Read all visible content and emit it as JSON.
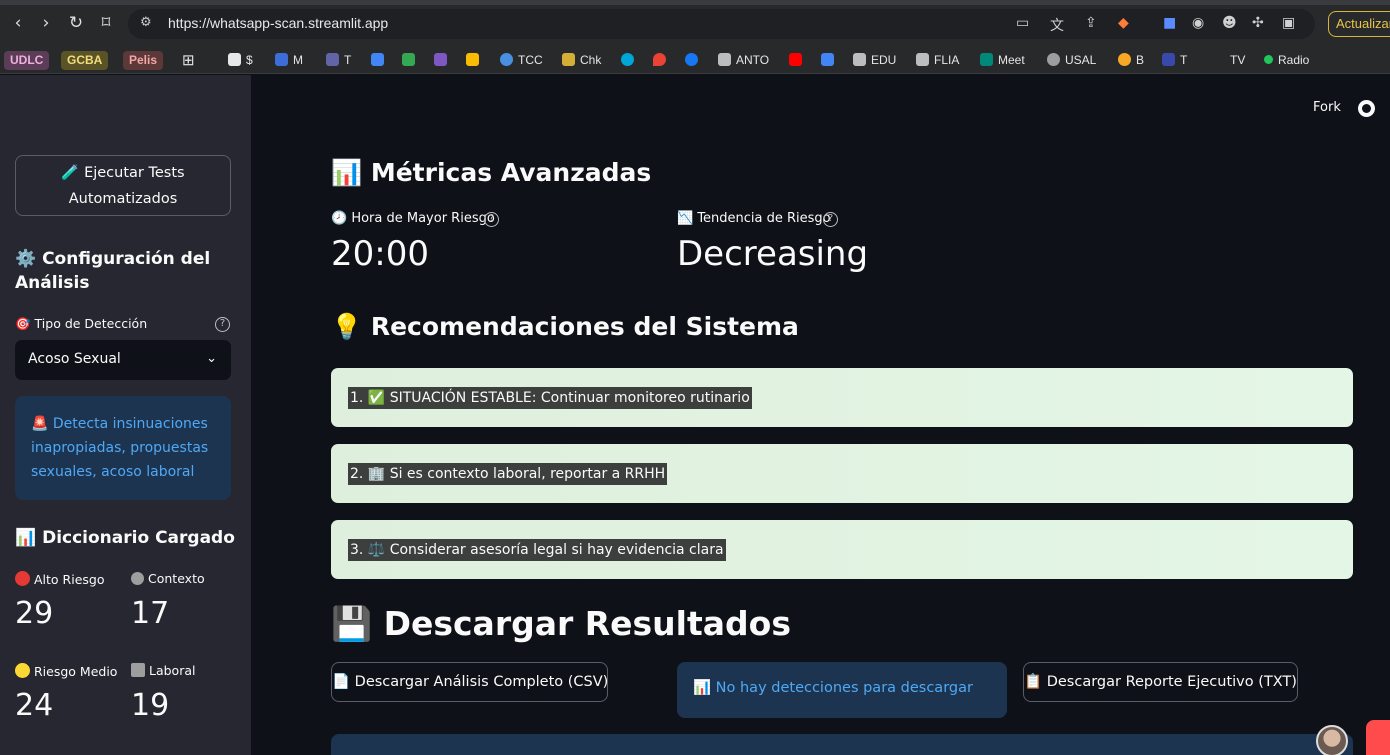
{
  "browser": {
    "url": "https://whatsapp-scan.streamlit.app",
    "update_label": "Actualizar",
    "bookmarks": [
      {
        "label": "UDLC",
        "kind": "pill",
        "bg": "#5b3d57",
        "fg": "#f0b0de"
      },
      {
        "label": "GCBA",
        "kind": "pill",
        "bg": "#5a5326",
        "fg": "#f3dc7d"
      },
      {
        "label": "Pelis",
        "kind": "pill",
        "bg": "#5d3838",
        "fg": "#f3a6a6"
      },
      {
        "label": "$",
        "kind": "link"
      },
      {
        "label": "M",
        "kind": "link"
      },
      {
        "label": "T",
        "kind": "link"
      },
      {
        "label": "TCC",
        "kind": "link"
      },
      {
        "label": "Chk",
        "kind": "link"
      },
      {
        "label": "ANTO",
        "kind": "folder"
      },
      {
        "label": "EDU",
        "kind": "folder"
      },
      {
        "label": "FLIA",
        "kind": "folder"
      },
      {
        "label": "Meet",
        "kind": "link"
      },
      {
        "label": "USAL",
        "kind": "link"
      },
      {
        "label": "B",
        "kind": "link"
      },
      {
        "label": "T",
        "kind": "link"
      },
      {
        "label": "TV",
        "kind": "link"
      },
      {
        "label": "Radio",
        "kind": "link"
      }
    ]
  },
  "header": {
    "fork_label": "Fork"
  },
  "sidebar": {
    "tests_button": "🧪 Ejecutar Tests Automatizados",
    "config_title": "⚙️ Configuración del Análisis",
    "detection_label": "🎯 Tipo de Detección",
    "detection_value": "Acoso Sexual",
    "detection_info": "🚨 Detecta insinuaciones inapropiadas, propuestas sexuales, acoso laboral",
    "dictionary_title": "📊 Diccionario Cargado",
    "metrics": [
      {
        "label": "Alto Riesgo",
        "value": "29",
        "icon": "red-circle-icon",
        "color": "#e53935"
      },
      {
        "label": "Contexto",
        "value": "17",
        "icon": "magnifier-icon",
        "color": "#9e9e9e"
      },
      {
        "label": "Riesgo Medio",
        "value": "24",
        "icon": "yellow-circle-icon",
        "color": "#fdd835"
      },
      {
        "label": "Laboral",
        "value": "19",
        "icon": "office-icon",
        "color": "#9e9e9e"
      }
    ]
  },
  "main": {
    "metrics_title": "📊 Métricas Avanzadas",
    "peak_hour_label": "🕗 Hora de Mayor Riesgo",
    "peak_hour_value": "20:00",
    "trend_label": "📉 Tendencia de Riesgo",
    "trend_value": "Decreasing",
    "recs_title": "💡 Recomendaciones del Sistema",
    "recommendations": [
      "1. ✅ SITUACIÓN ESTABLE: Continuar monitoreo rutinario",
      "2. 🏢 Si es contexto laboral, reportar a RRHH",
      "3. ⚖️ Considerar asesoría legal si hay evidencia clara"
    ],
    "download_title": "💾 Descargar Resultados",
    "download_csv": "📄 Descargar Análisis Completo (CSV)",
    "no_detections": "📊 No hay detecciones para descargar",
    "download_txt": "📋 Descargar Reporte Ejecutivo (TXT)"
  }
}
